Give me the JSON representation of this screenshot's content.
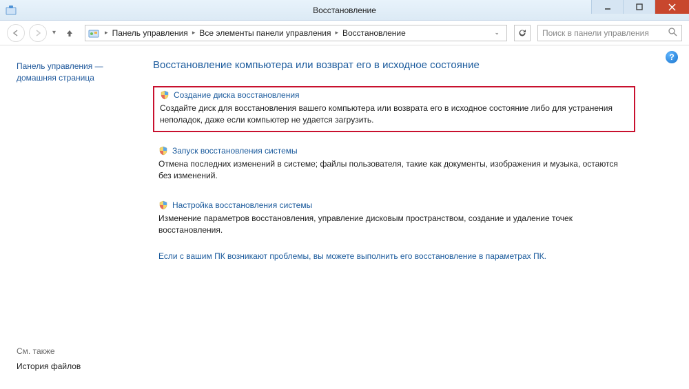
{
  "window": {
    "title": "Восстановление"
  },
  "breadcrumb": {
    "items": [
      "Панель управления",
      "Все элементы панели управления",
      "Восстановление"
    ]
  },
  "search": {
    "placeholder": "Поиск в панели управления"
  },
  "sidebar": {
    "home_line1": "Панель управления —",
    "home_line2": "домашняя страница",
    "see_also": "См. также",
    "file_history": "История файлов"
  },
  "main": {
    "heading": "Восстановление компьютера или возврат его в исходное состояние",
    "options": [
      {
        "title": "Создание диска восстановления",
        "desc": "Создайте диск для восстановления вашего компьютера или возврата его в исходное состояние либо для устранения неполадок, даже если компьютер не удается загрузить."
      },
      {
        "title": "Запуск восстановления системы",
        "desc": "Отмена последних изменений в системе; файлы пользователя, такие как документы, изображения и музыка, остаются без изменений."
      },
      {
        "title": "Настройка восстановления системы",
        "desc": "Изменение параметров восстановления, управление дисковым пространством, создание и удаление точек восстановления."
      }
    ],
    "footer_link": "Если с вашим ПК возникают проблемы, вы можете выполнить его восстановление в параметрах ПК."
  },
  "help": "?"
}
